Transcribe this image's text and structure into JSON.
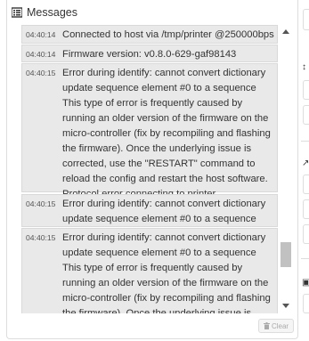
{
  "header": {
    "title": "Messages",
    "icon": "list-icon"
  },
  "log": [
    {
      "time": "04:40:14",
      "text": "Connected to host via /tmp/printer @250000bps"
    },
    {
      "time": "04:40:14",
      "text": "Firmware version: v0.8.0-629-gaf98143"
    },
    {
      "time": "04:40:15",
      "text": "Error during identify: cannot convert dictionary\nupdate sequence element #0 to a sequence\nThis type of error is frequently caused by\nrunning an older version of the firmware on the\nmicro-controller (fix by recompiling and flashing\nthe firmware). Once the underlying issue is\ncorrected, use the \"RESTART\" command to\nreload the config and restart the host software.\nProtocol error connecting to printer"
    },
    {
      "time": "04:40:15",
      "text": "Error during identify: cannot convert dictionary\nupdate sequence element #0 to a sequence"
    },
    {
      "time": "04:40:15",
      "text": "Error during identify: cannot convert dictionary\nupdate sequence element #0 to a sequence\nThis type of error is frequently caused by\nrunning an older version of the firmware on the\nmicro-controller (fix by recompiling and flashing\nthe firmware). Once the underlying issue is"
    }
  ],
  "clear_button": {
    "label": "Clear",
    "icon": "trash-icon"
  },
  "colors": {
    "entry_bg": "#e9e9e9",
    "text": "#333333",
    "border": "#dddddd"
  }
}
